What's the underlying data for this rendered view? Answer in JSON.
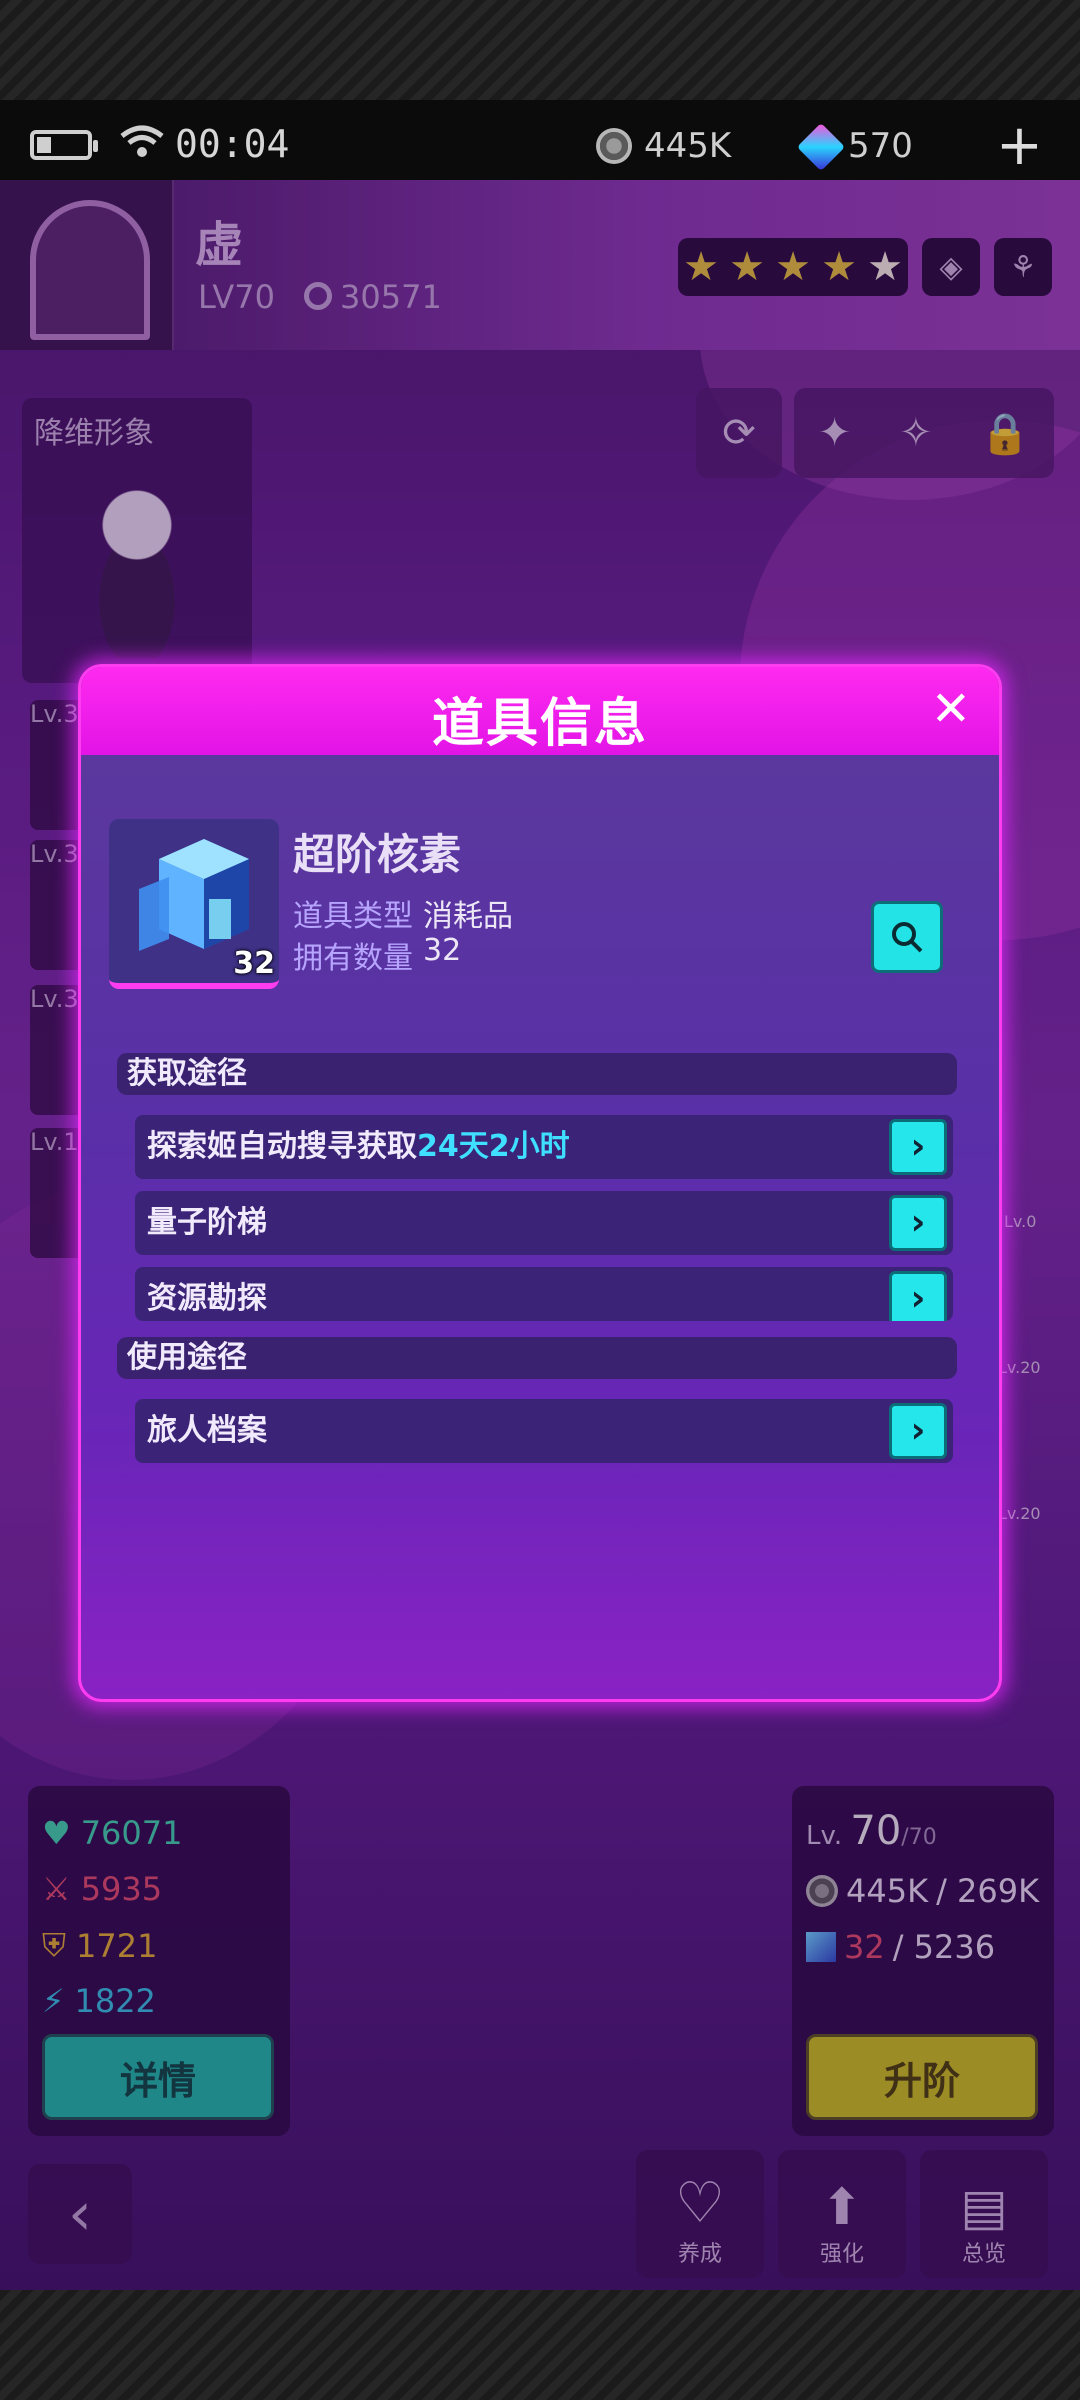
{
  "status_bar": {
    "time": "00:04",
    "coins": "445K",
    "gems": "570",
    "add_icon": "plus-icon"
  },
  "character": {
    "name": "虚",
    "level": "LV70",
    "power": "30571",
    "portrait_label": "降维形象",
    "lv_tabs": [
      "Lv.3",
      "Lv.3",
      "Lv.3",
      "Lv.1"
    ]
  },
  "side_levels": [
    "Lv.0",
    "Lv.20",
    "Lv.20"
  ],
  "stats": {
    "hp": "76071",
    "atk": "5935",
    "def": "1721",
    "spd": "1822",
    "detail_button": "详情"
  },
  "upgrade": {
    "lv_prefix": "Lv.",
    "lv_current": "70",
    "lv_max": "/70",
    "coins": "445K",
    "coins_need": "/ 269K",
    "cores": "32",
    "cores_need": "/ 5236",
    "button": "升阶"
  },
  "bottom_nav": {
    "nurture": "养成",
    "enhance": "强化",
    "overview": "总览"
  },
  "dialog": {
    "title": "道具信息",
    "item_name": "超阶核素",
    "item_count": "32",
    "type_label": "道具类型",
    "type_value": "消耗品",
    "own_label": "拥有数量",
    "own_value": "32",
    "obtain_title": "获取途径",
    "obtain_routes": [
      {
        "label": "探索姬自动搜寻获取",
        "highlight": "24天2小时"
      },
      {
        "label": "量子阶梯",
        "highlight": ""
      },
      {
        "label": "资源勘探",
        "highlight": ""
      }
    ],
    "use_title": "使用途径",
    "use_routes": [
      {
        "label": "旅人档案"
      }
    ]
  },
  "colors": {
    "dialog_header": "#ff2af0",
    "accent_cyan": "#25e6ea",
    "hp_green": "#3fd6a8",
    "atk_red": "#e0506a",
    "def_yellow": "#e0b030",
    "spd_blue": "#35c2e0"
  }
}
